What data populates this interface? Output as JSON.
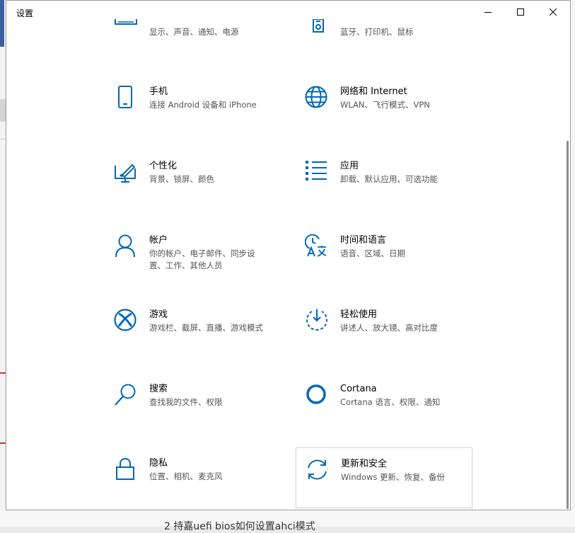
{
  "window": {
    "title": "设置",
    "controls": {
      "minimize": "minimize-icon",
      "maximize": "maximize-icon",
      "close": "close-icon"
    }
  },
  "accent_color": "#0067b8",
  "items": [
    {
      "name": "",
      "desc": "显示、声音、通知、电源",
      "icon": "display-icon"
    },
    {
      "name": "",
      "desc": "蓝牙、打印机、鼠标",
      "icon": "devices-icon"
    },
    {
      "name": "手机",
      "desc": "连接 Android 设备和 iPhone",
      "icon": "phone-icon"
    },
    {
      "name": "网络和 Internet",
      "desc": "WLAN、飞行模式、VPN",
      "icon": "globe-icon"
    },
    {
      "name": "个性化",
      "desc": "背景、锁屏、颜色",
      "icon": "personalization-icon"
    },
    {
      "name": "应用",
      "desc": "卸载、默认应用、可选功能",
      "icon": "apps-list-icon"
    },
    {
      "name": "帐户",
      "desc": "你的帐户、电子邮件、同步设置、工作、其他人员",
      "icon": "person-icon"
    },
    {
      "name": "时间和语言",
      "desc": "语音、区域、日期",
      "icon": "time-language-icon"
    },
    {
      "name": "游戏",
      "desc": "游戏栏、截屏、直播、游戏模式",
      "icon": "xbox-icon"
    },
    {
      "name": "轻松使用",
      "desc": "讲述人、放大镜、高对比度",
      "icon": "ease-of-access-icon"
    },
    {
      "name": "搜索",
      "desc": "查找我的文件、权限",
      "icon": "search-icon"
    },
    {
      "name": "Cortana",
      "desc": "Cortana 语言、权限、通知",
      "icon": "cortana-icon"
    },
    {
      "name": "隐私",
      "desc": "位置、相机、麦克风",
      "icon": "lock-icon"
    },
    {
      "name": "更新和安全",
      "desc": "Windows 更新、恢复、备份",
      "icon": "sync-icon"
    }
  ],
  "background_fragment": "2    持嘉uefi bios如何设置ahci模式"
}
